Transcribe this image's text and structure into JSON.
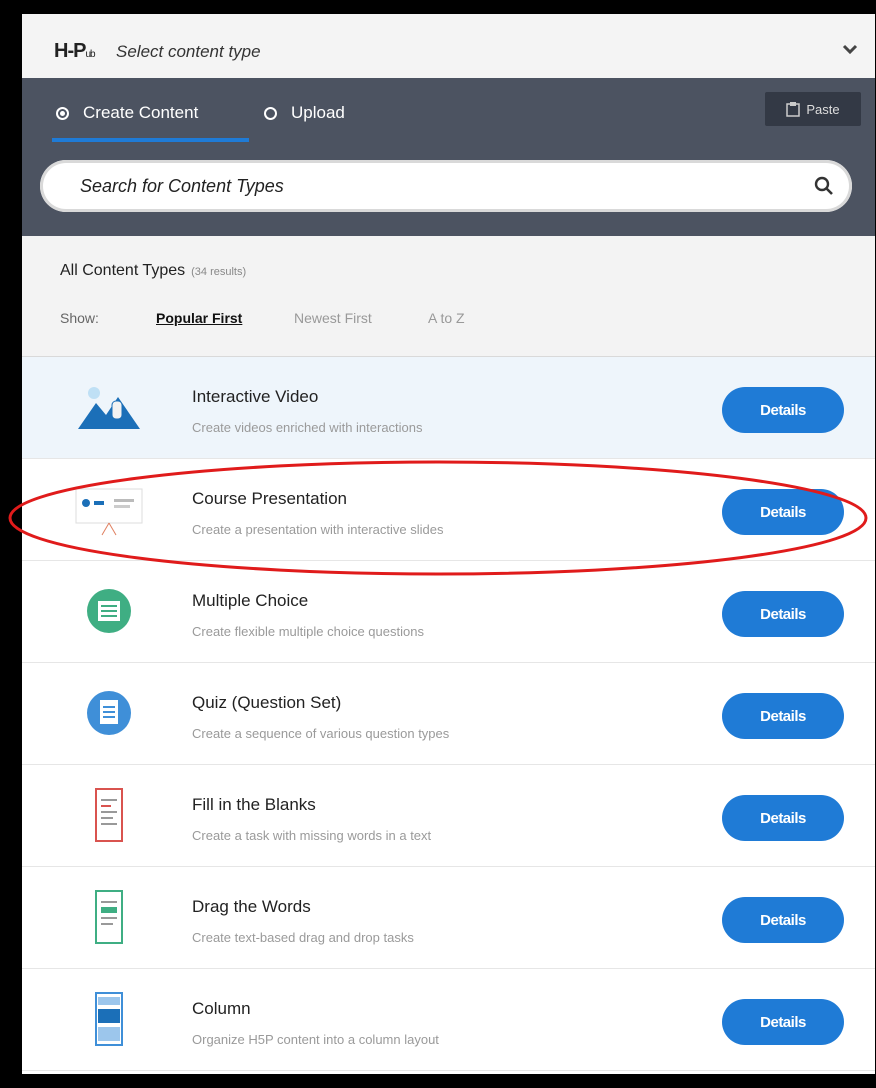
{
  "header": {
    "logo": "H-P",
    "logo_suffix": "ub",
    "title": "Select content type"
  },
  "tabs": {
    "create": "Create Content",
    "upload": "Upload",
    "paste": "Paste"
  },
  "search": {
    "placeholder": "Search for Content Types"
  },
  "filter": {
    "heading": "All Content Types",
    "count": "(34 results)",
    "show_label": "Show:",
    "sort_options": [
      "Popular First",
      "Newest First",
      "A to Z"
    ]
  },
  "content_types": [
    {
      "title": "Interactive Video",
      "description": "Create videos enriched with interactions",
      "button": "Details"
    },
    {
      "title": "Course Presentation",
      "description": "Create a presentation with interactive slides",
      "button": "Details"
    },
    {
      "title": "Multiple Choice",
      "description": "Create flexible multiple choice questions",
      "button": "Details"
    },
    {
      "title": "Quiz (Question Set)",
      "description": "Create a sequence of various question types",
      "button": "Details"
    },
    {
      "title": "Fill in the Blanks",
      "description": "Create a task with missing words in a text",
      "button": "Details"
    },
    {
      "title": "Drag the Words",
      "description": "Create text-based drag and drop tasks",
      "button": "Details"
    },
    {
      "title": "Column",
      "description": "Organize H5P content into a column layout",
      "button": "Details"
    }
  ],
  "colors": {
    "accent": "#1f7bd6",
    "tabbar": "#4c5361",
    "annotation": "#e01b1b"
  }
}
